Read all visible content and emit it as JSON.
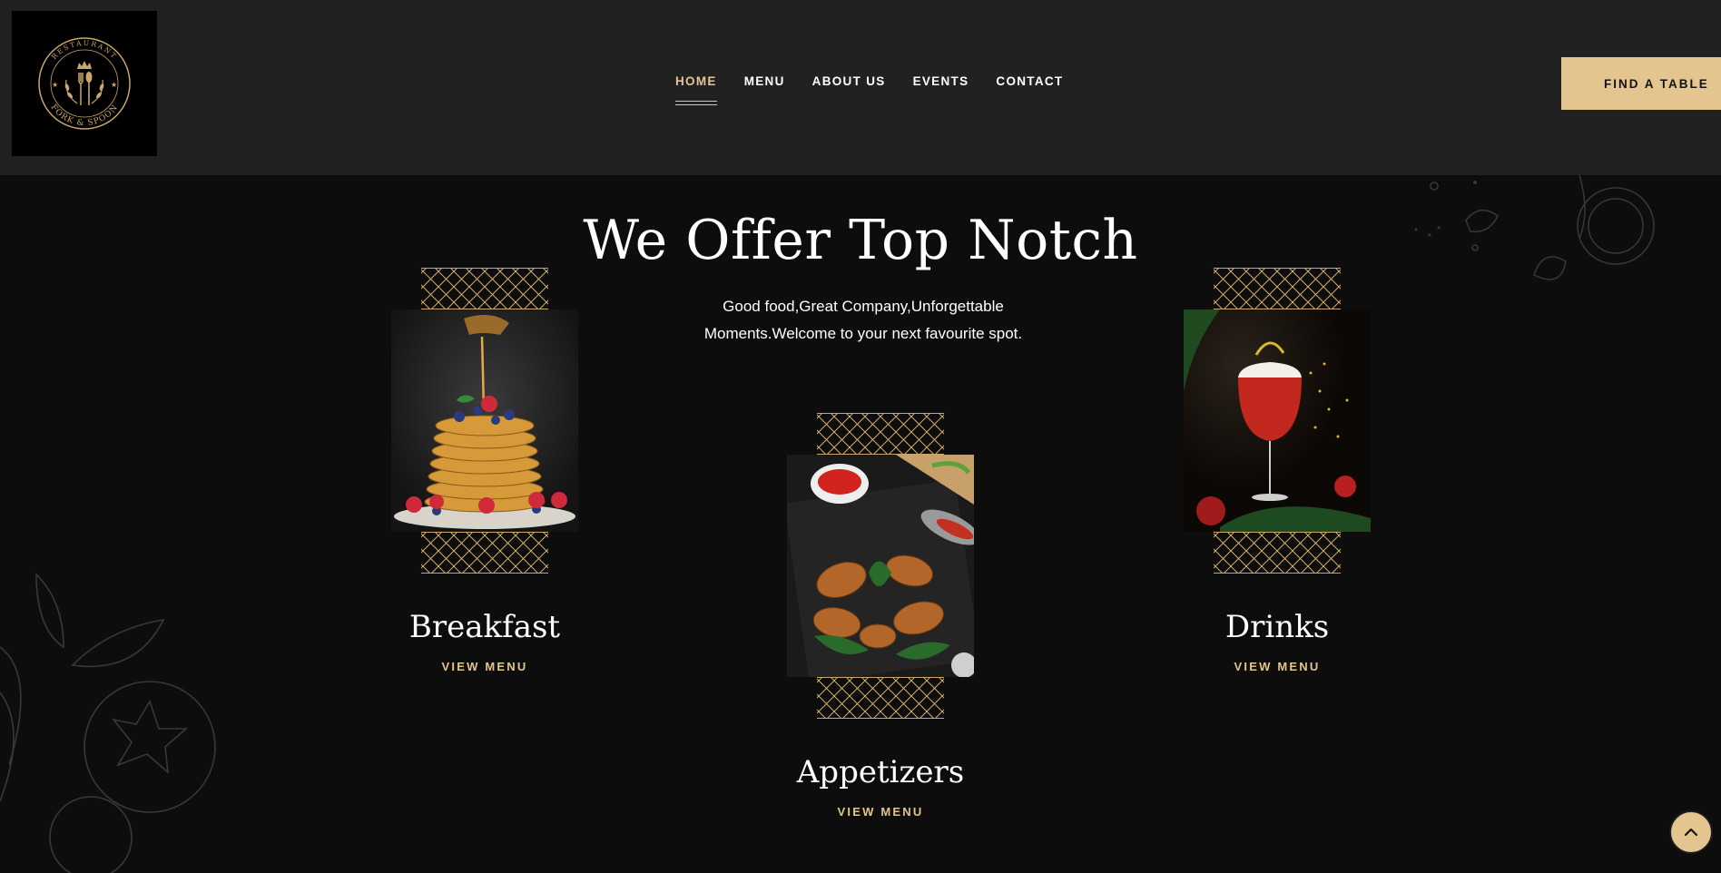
{
  "brand": {
    "logo_text_top": "RESTAURANT",
    "logo_text_bottom": "FORK & SPOON",
    "accent": "#e4c590",
    "header_bg": "#222121",
    "page_bg": "#0e0d0d"
  },
  "nav": {
    "items": [
      {
        "label": "HOME",
        "active": true
      },
      {
        "label": "MENU",
        "active": false
      },
      {
        "label": "ABOUT US",
        "active": false
      },
      {
        "label": "EVENTS",
        "active": false
      },
      {
        "label": "CONTACT",
        "active": false
      }
    ],
    "cta_label": "FIND A TABLE"
  },
  "hero": {
    "title": "We Offer Top Notch",
    "subtitle_line1": "Good food,Great Company,Unforgettable",
    "subtitle_line2": "Moments.Welcome to your next favourite spot."
  },
  "cards": [
    {
      "name": "Breakfast",
      "link": "VIEW MENU",
      "image": "pancakes-with-honey-and-berries"
    },
    {
      "name": "Appetizers",
      "link": "VIEW MENU",
      "image": "grilled-chicken-wings-with-sauce"
    },
    {
      "name": "Drinks",
      "link": "VIEW MENU",
      "image": "red-cocktail-glass"
    }
  ],
  "icons": {
    "scroll_top": "chevron-up-icon"
  }
}
